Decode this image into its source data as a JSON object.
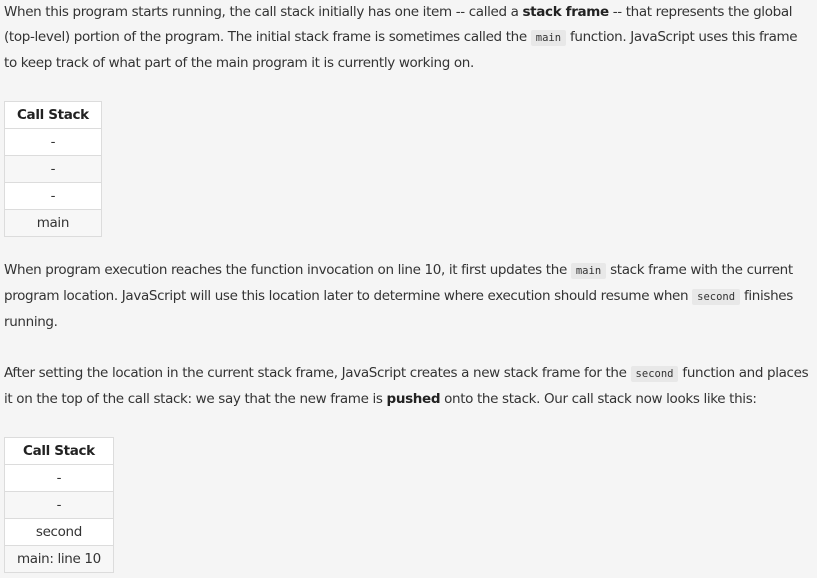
{
  "para1": {
    "t1": "When this program starts running, the call stack initially has one item -- called a ",
    "b1": "stack frame",
    "t2": " -- that represents the global (top-level) portion of the program. The initial stack frame is sometimes called the ",
    "c1": "main",
    "t3": " function. JavaScript uses this frame to keep track of what part of the main program it is currently working on."
  },
  "table1": {
    "header": "Call Stack",
    "rows": [
      "-",
      "-",
      "-",
      "main"
    ]
  },
  "para2": {
    "t1": "When program execution reaches the function invocation on line 10, it first updates the ",
    "c1": "main",
    "t2": " stack frame with the current program location. JavaScript will use this location later to determine where execution should resume when ",
    "c2": "second",
    "t3": " finishes running."
  },
  "para3": {
    "t1": "After setting the location in the current stack frame, JavaScript creates a new stack frame for the ",
    "c1": "second",
    "t2": " function and places it on the top of the call stack: we say that the new frame is ",
    "b1": "pushed",
    "t3": " onto the stack. Our call stack now looks like this:"
  },
  "table2": {
    "header": "Call Stack",
    "rows": [
      "-",
      "-",
      "second",
      "main: line 10"
    ]
  }
}
